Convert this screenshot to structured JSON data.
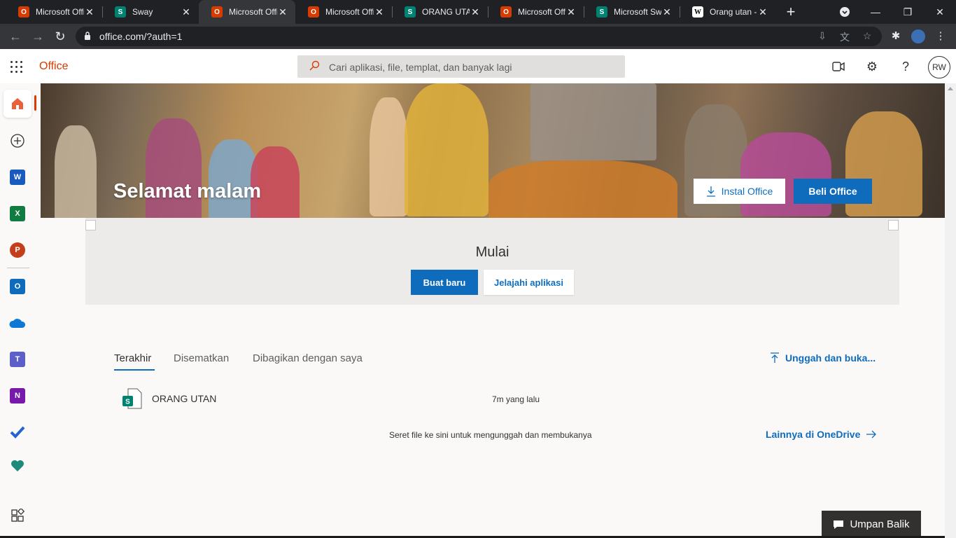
{
  "browser": {
    "tabs": [
      {
        "title": "Microsoft Offi",
        "icon": "office-icon",
        "active": false
      },
      {
        "title": "Sway",
        "icon": "sway-icon",
        "active": false
      },
      {
        "title": "Microsoft Offi",
        "icon": "office-icon",
        "active": true
      },
      {
        "title": "Microsoft Offi",
        "icon": "office-icon",
        "active": false
      },
      {
        "title": "ORANG UTAN",
        "icon": "sway-icon",
        "active": false
      },
      {
        "title": "Microsoft Offi",
        "icon": "office-icon",
        "active": false
      },
      {
        "title": "Microsoft Swa",
        "icon": "sway-icon",
        "active": false
      },
      {
        "title": "Orang utan - ",
        "icon": "wikipedia-icon",
        "active": false
      }
    ],
    "url": "office.com/?auth=1"
  },
  "header": {
    "brand": "Office",
    "search_placeholder": "Cari aplikasi, file, templat, dan banyak lagi",
    "user_initials": "RW"
  },
  "hero": {
    "greeting": "Selamat malam",
    "install_label": "Instal Office",
    "buy_label": "Beli Office"
  },
  "start": {
    "title": "Mulai",
    "new_label": "Buat baru",
    "explore_label": "Jelajahi aplikasi"
  },
  "files": {
    "tabs": [
      "Terakhir",
      "Disematkan",
      "Dibagikan dengan saya"
    ],
    "upload_label": "Unggah dan buka...",
    "items": [
      {
        "name": "ORANG UTAN",
        "time": "7m yang lalu",
        "icon": "sway-file-icon"
      }
    ],
    "drop_hint": "Seret file ke sini untuk mengunggah dan membukanya",
    "more_label": "Lainnya di OneDrive"
  },
  "feedback_label": "Umpan Balik",
  "colors": {
    "accent": "#0f6cbd",
    "brand": "#d83b01"
  }
}
